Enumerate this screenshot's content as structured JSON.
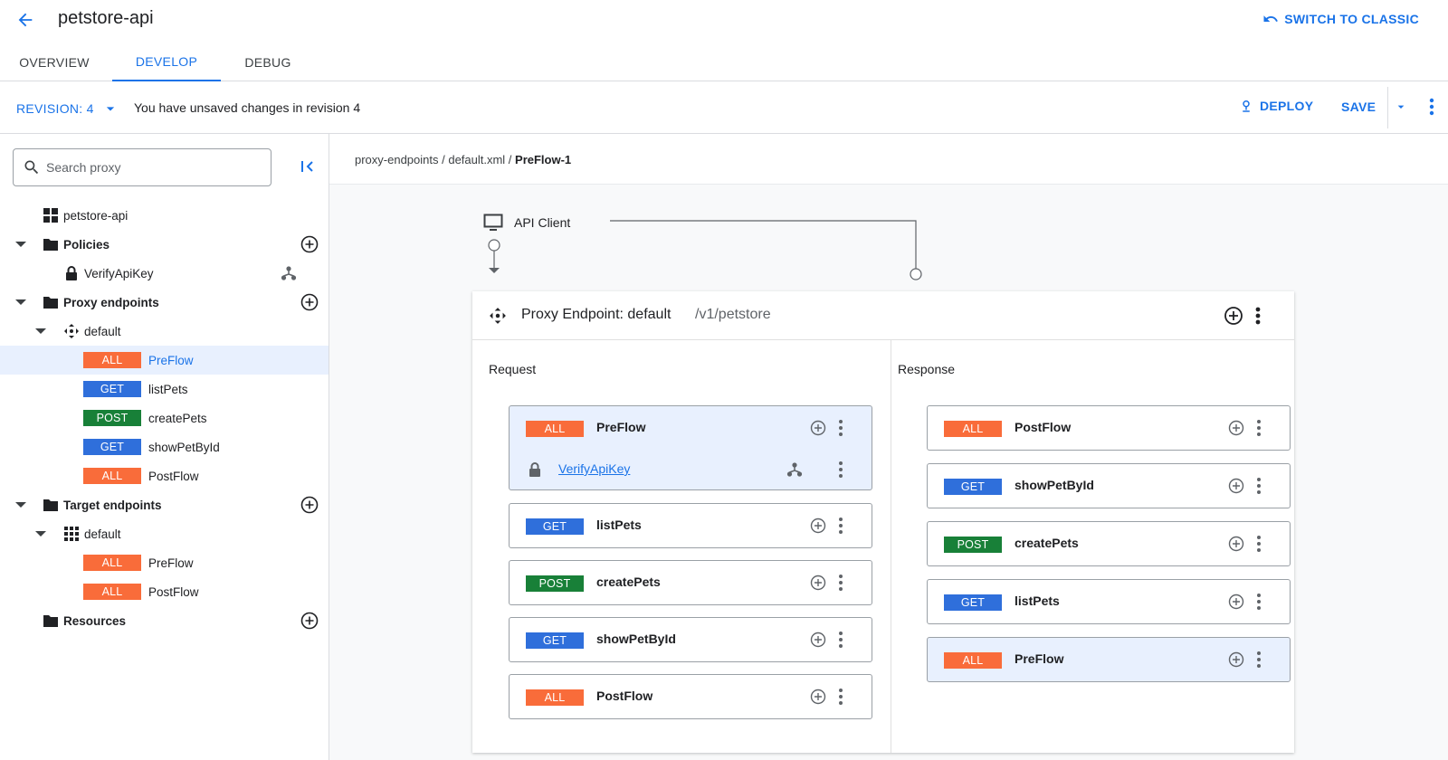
{
  "header": {
    "title": "petstore-api",
    "switch_classic": "SWITCH TO CLASSIC",
    "icons": {
      "back": "arrow-back-icon",
      "switch": "undo-icon"
    }
  },
  "tabs": [
    {
      "label": "OVERVIEW",
      "active": false
    },
    {
      "label": "DEVELOP",
      "active": true
    },
    {
      "label": "DEBUG",
      "active": false
    }
  ],
  "revision_bar": {
    "revision_label": "REVISION: 4",
    "unsaved_text": "You have unsaved changes in revision 4",
    "deploy_label": "DEPLOY",
    "save_label": "SAVE"
  },
  "sidebar": {
    "search_placeholder": "Search proxy",
    "tree": {
      "root": "petstore-api",
      "policies": {
        "label": "Policies",
        "items": [
          {
            "label": "VerifyApiKey"
          }
        ]
      },
      "proxy_endpoints": {
        "label": "Proxy endpoints",
        "default_label": "default",
        "flows": [
          {
            "method": "ALL",
            "label": "PreFlow",
            "selected": true
          },
          {
            "method": "GET",
            "label": "listPets"
          },
          {
            "method": "POST",
            "label": "createPets"
          },
          {
            "method": "GET",
            "label": "showPetById"
          },
          {
            "method": "ALL",
            "label": "PostFlow"
          }
        ]
      },
      "target_endpoints": {
        "label": "Target endpoints",
        "default_label": "default",
        "flows": [
          {
            "method": "ALL",
            "label": "PreFlow"
          },
          {
            "method": "ALL",
            "label": "PostFlow"
          }
        ]
      },
      "resources": {
        "label": "Resources"
      }
    }
  },
  "main": {
    "breadcrumb": {
      "path": "proxy-endpoints / default.xml / ",
      "current": "PreFlow-1"
    },
    "api_client_label": "API Client",
    "proxy_endpoint": {
      "title": "Proxy Endpoint: default",
      "base_path": "/v1/petstore",
      "request_title": "Request",
      "response_title": "Response",
      "request_flows": [
        {
          "method": "ALL",
          "label": "PreFlow",
          "selected": true,
          "policy": "VerifyApiKey"
        },
        {
          "method": "GET",
          "label": "listPets"
        },
        {
          "method": "POST",
          "label": "createPets"
        },
        {
          "method": "GET",
          "label": "showPetById"
        },
        {
          "method": "ALL",
          "label": "PostFlow"
        }
      ],
      "response_flows": [
        {
          "method": "ALL",
          "label": "PostFlow"
        },
        {
          "method": "GET",
          "label": "showPetById"
        },
        {
          "method": "POST",
          "label": "createPets"
        },
        {
          "method": "GET",
          "label": "listPets"
        },
        {
          "method": "ALL",
          "label": "PreFlow",
          "selected": true
        }
      ]
    }
  },
  "colors": {
    "accent": "#1a73e8",
    "method_all": "#f96c3a",
    "method_get": "#2f6fdb",
    "method_post": "#188038",
    "selected_bg": "#e8f0fe"
  }
}
